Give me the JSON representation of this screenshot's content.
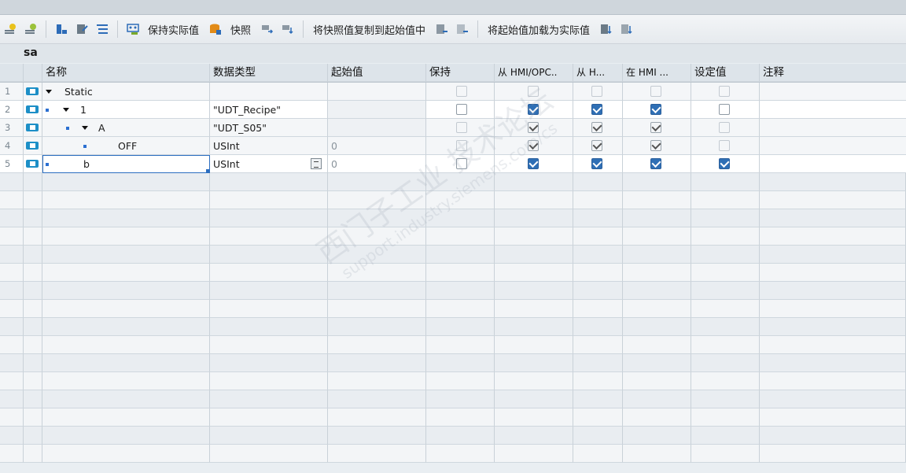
{
  "toolbar": {
    "keep_actual_label": "保持实际值",
    "snapshot_label": "快照",
    "copy_snapshot_label": "将快照值复制到起始值中",
    "load_start_label": "将起始值加载为实际值",
    "colors": {
      "accent": "#2f6fb5",
      "icon_green": "#7aa82a",
      "icon_orange": "#e28b17"
    }
  },
  "block": {
    "title": "sa"
  },
  "columns": [
    "名称",
    "数据类型",
    "起始值",
    "保持",
    "从 HMI/OPC..",
    "从 H...",
    "在 HMI ...",
    "设定值",
    "注释"
  ],
  "rows": [
    {
      "num": "1",
      "name": "Static",
      "type": "",
      "start": "",
      "keep": "grey",
      "from_hmi_opc": "grey",
      "from_h": "grey",
      "in_hmi": "grey",
      "setpoint": "grey",
      "comment": ""
    },
    {
      "num": "2",
      "name": "1",
      "type": "\"UDT_Recipe\"",
      "start": "",
      "keep": "empty",
      "from_hmi_opc": "checked",
      "from_h": "checked",
      "in_hmi": "checked",
      "setpoint": "empty",
      "comment": ""
    },
    {
      "num": "3",
      "name": "A",
      "type": "\"UDT_S05\"",
      "start": "",
      "keep": "grey",
      "from_hmi_opc": "checked-grey",
      "from_h": "checked-grey",
      "in_hmi": "checked-grey",
      "setpoint": "grey",
      "comment": ""
    },
    {
      "num": "4",
      "name": "OFF",
      "type": "USInt",
      "start": "0",
      "keep": "grey",
      "from_hmi_opc": "checked-grey",
      "from_h": "checked-grey",
      "in_hmi": "checked-grey",
      "setpoint": "grey",
      "comment": ""
    },
    {
      "num": "5",
      "name": "b",
      "type": "USInt",
      "start": "0",
      "keep": "empty",
      "from_hmi_opc": "checked",
      "from_h": "checked",
      "in_hmi": "checked",
      "setpoint": "checked",
      "comment": ""
    }
  ],
  "watermark": {
    "line1": "西门子工业 技术论坛",
    "line2": "support.industry.siemens.com/cs"
  }
}
